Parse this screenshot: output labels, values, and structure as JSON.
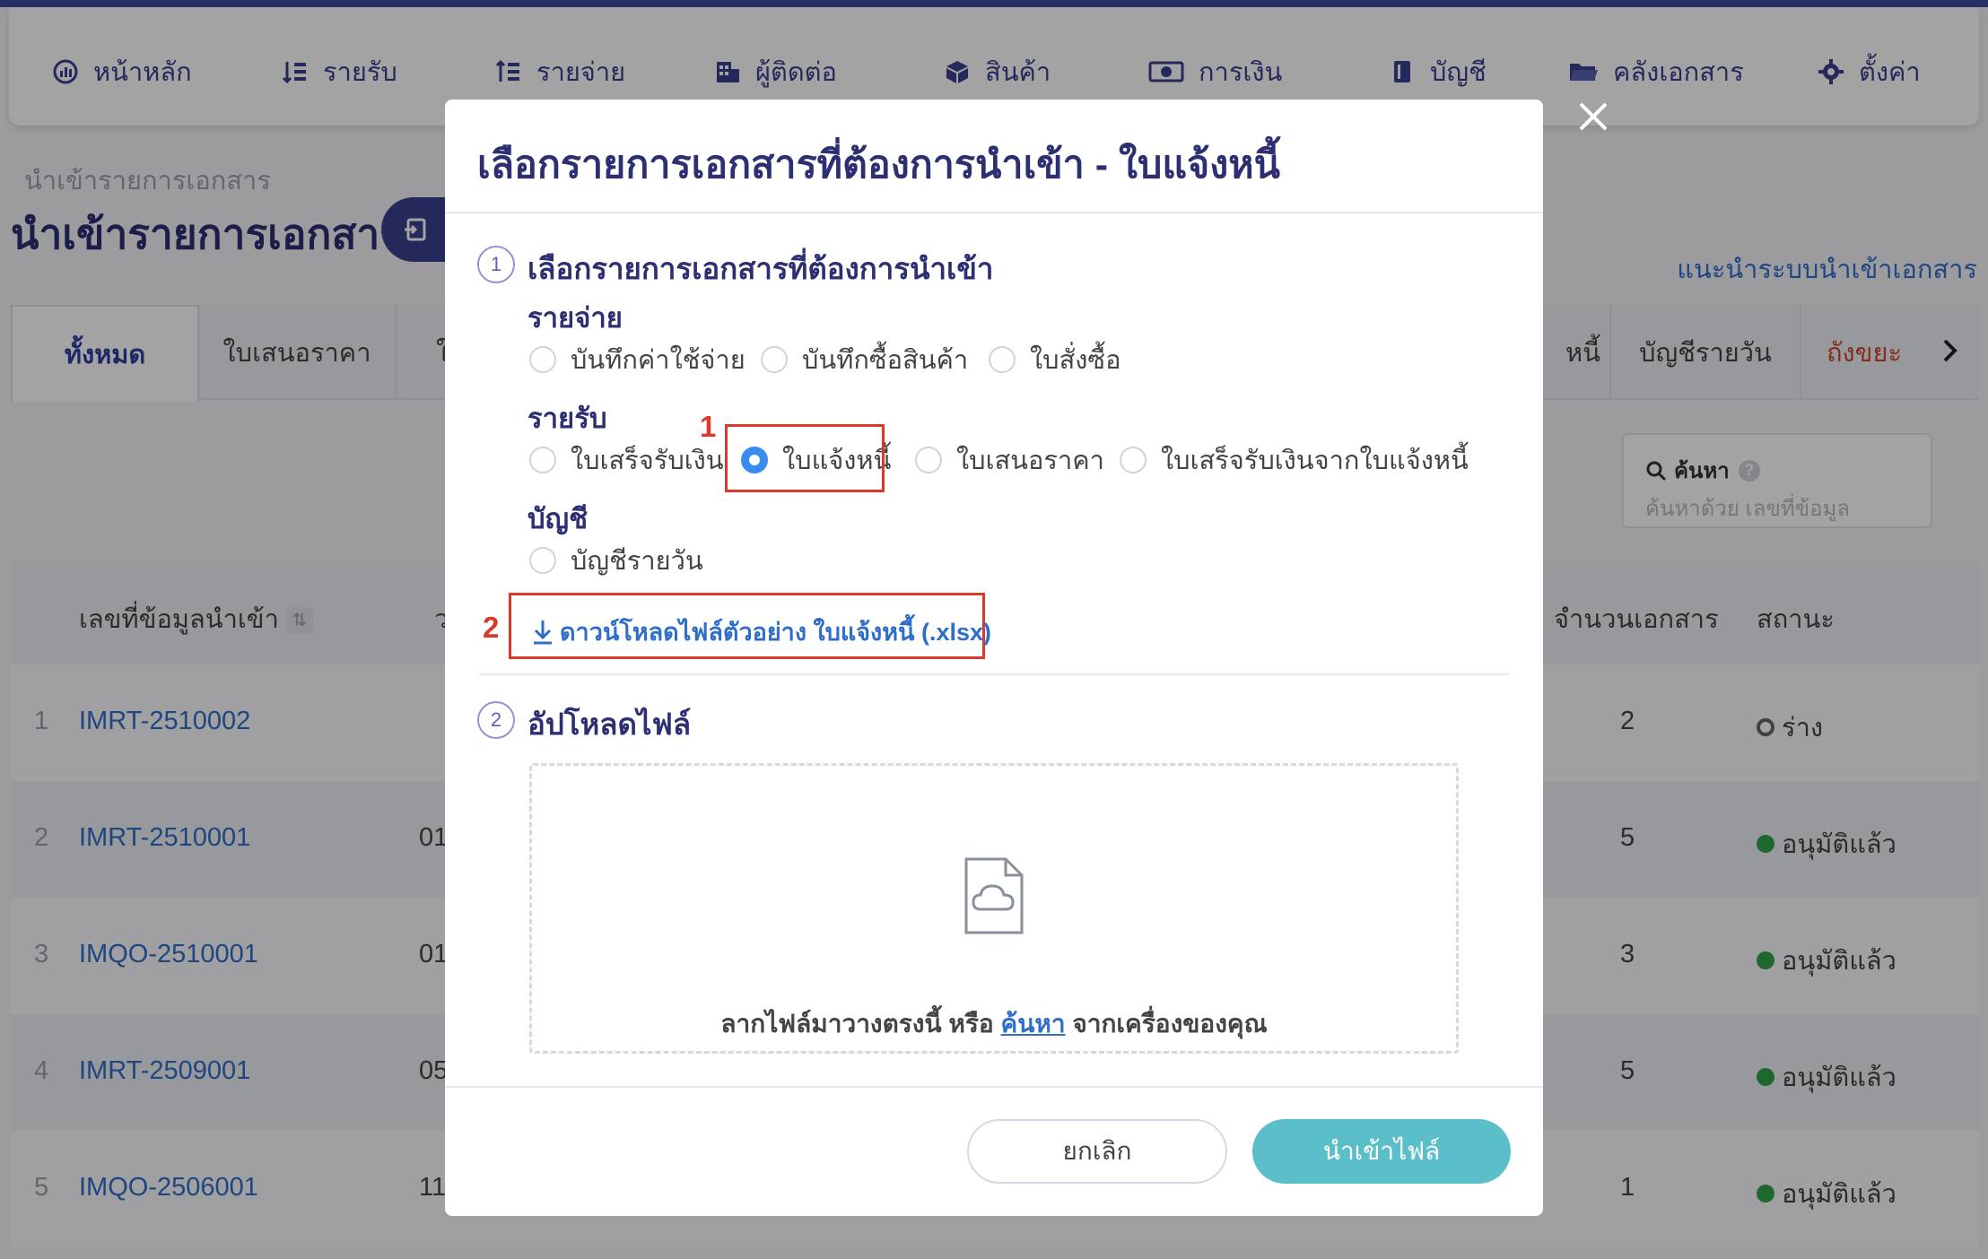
{
  "nav": {
    "items": [
      {
        "label": "หน้าหลัก",
        "icon": "dashboard-icon"
      },
      {
        "label": "รายรับ",
        "icon": "income-icon"
      },
      {
        "label": "รายจ่าย",
        "icon": "expense-icon"
      },
      {
        "label": "ผู้ติดต่อ",
        "icon": "contacts-icon"
      },
      {
        "label": "สินค้า",
        "icon": "product-box-icon"
      },
      {
        "label": "การเงิน",
        "icon": "money-icon"
      },
      {
        "label": "บัญชี",
        "icon": "ledger-icon"
      },
      {
        "label": "คลังเอกสาร",
        "icon": "folder-icon"
      },
      {
        "label": "ตั้งค่า",
        "icon": "gear-icon"
      }
    ]
  },
  "page": {
    "breadcrumb": "นำเข้ารายการเอกสาร",
    "title": "นำเข้ารายการเอกสาร",
    "guide_link": "แนะนำระบบนำเข้าเอกสาร"
  },
  "tabs": {
    "items": [
      "ทั้งหมด",
      "ใบเสนอราคา",
      "ใ",
      "หนี้",
      "บัญชีรายวัน",
      "ถังขยะ"
    ],
    "active": "ทั้งหมด"
  },
  "search": {
    "label": "ค้นหา",
    "placeholder": "ค้นหาด้วย เลขที่ข้อมูล"
  },
  "table": {
    "columns": {
      "id": "เลขที่ข้อมูลนำเข้า",
      "date_partial": "ว",
      "count": "จำนวนเอกสาร",
      "status": "สถานะ"
    },
    "rows": [
      {
        "idx": "1",
        "code": "IMRT-2510002",
        "date": "",
        "count": "2",
        "status": "ร่าง",
        "status_type": "draft"
      },
      {
        "idx": "2",
        "code": "IMRT-2510001",
        "date": "01",
        "count": "5",
        "status": "อนุมัติแล้ว",
        "status_type": "approved"
      },
      {
        "idx": "3",
        "code": "IMQO-2510001",
        "date": "01",
        "count": "3",
        "status": "อนุมัติแล้ว",
        "status_type": "approved"
      },
      {
        "idx": "4",
        "code": "IMRT-2509001",
        "date": "05",
        "count": "5",
        "status": "อนุมัติแล้ว",
        "status_type": "approved"
      },
      {
        "idx": "5",
        "code": "IMQO-2506001",
        "date": "11",
        "count": "1",
        "status": "อนุมัติแล้ว",
        "status_type": "approved"
      }
    ]
  },
  "modal": {
    "title": "เลือกรายการเอกสารที่ต้องการนำเข้า - ใบแจ้งหนี้",
    "step1": {
      "number": "1",
      "title": "เลือกรายการเอกสารที่ต้องการนำเข้า"
    },
    "groups": {
      "expense": {
        "title": "รายจ่าย",
        "options": [
          "บันทึกค่าใช้จ่าย",
          "บันทึกซื้อสินค้า",
          "ใบสั่งซื้อ"
        ]
      },
      "income": {
        "title": "รายรับ",
        "options": [
          "ใบเสร็จรับเงิน",
          "ใบแจ้งหนี้",
          "ใบเสนอราคา",
          "ใบเสร็จรับเงินจากใบแจ้งหนี้"
        ],
        "selected": "ใบแจ้งหนี้"
      },
      "account": {
        "title": "บัญชี",
        "options": [
          "บัญชีรายวัน"
        ]
      }
    },
    "download_link": "ดาวน์โหลดไฟล์ตัวอย่าง ใบแจ้งหนี้ (.xlsx)",
    "annotations": [
      "1",
      "2"
    ],
    "step2": {
      "number": "2",
      "title": "อัปโหลดไฟล์"
    },
    "dropzone": {
      "text_before": "ลากไฟล์มาวางตรงนี้ หรือ ",
      "link": "ค้นหา",
      "text_after": " จากเครื่องของคุณ"
    },
    "buttons": {
      "cancel": "ยกเลิก",
      "import": "นำเข้าไฟล์"
    }
  },
  "colors": {
    "brand": "#3b3f8f",
    "link": "#2f6ec8",
    "highlight": "#d93a2a",
    "import_button": "#5bbfca",
    "approved": "#2fa34a"
  }
}
